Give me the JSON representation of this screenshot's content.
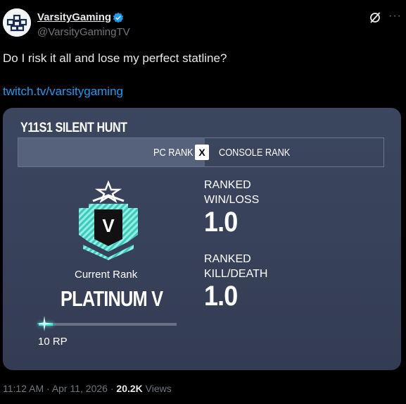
{
  "tweet": {
    "display_name": "VarsityGaming",
    "handle": "@VarsityGamingTV",
    "text": "Do I risk it all and lose my perfect statline?",
    "link": "twitch.tv/varsitygaming",
    "time": "11:12 AM",
    "date": "Apr 11, 2026",
    "views_count": "20.2K",
    "views_label": "Views",
    "separator": "·"
  },
  "card": {
    "season_title": "Y11S1 SILENT HUNT",
    "tab_pc": "PC RANK",
    "tab_divider": "X",
    "tab_console": "CONSOLE RANK",
    "rank_letter": "V",
    "current_rank_label": "Current Rank",
    "rank_name": "PLATINUM V",
    "rp_value": "10 RP",
    "rp_progress": 0.1,
    "winloss_label_1": "RANKED",
    "winloss_label_2": "WIN/LOSS",
    "winloss_value": "1.0",
    "kd_label_1": "RANKED",
    "kd_label_2": "KILL/DEATH",
    "kd_value": "1.0"
  },
  "colors": {
    "link": "#1d9bf0",
    "verified": "#1d9bf0",
    "platinum": "#4fe0d0"
  },
  "icons": {
    "avatar": "varsity-gaming-logo",
    "verified": "verified-badge-icon",
    "grok": "grok-icon",
    "more": "more-icon",
    "rank": "platinum-rank-emblem-icon"
  }
}
